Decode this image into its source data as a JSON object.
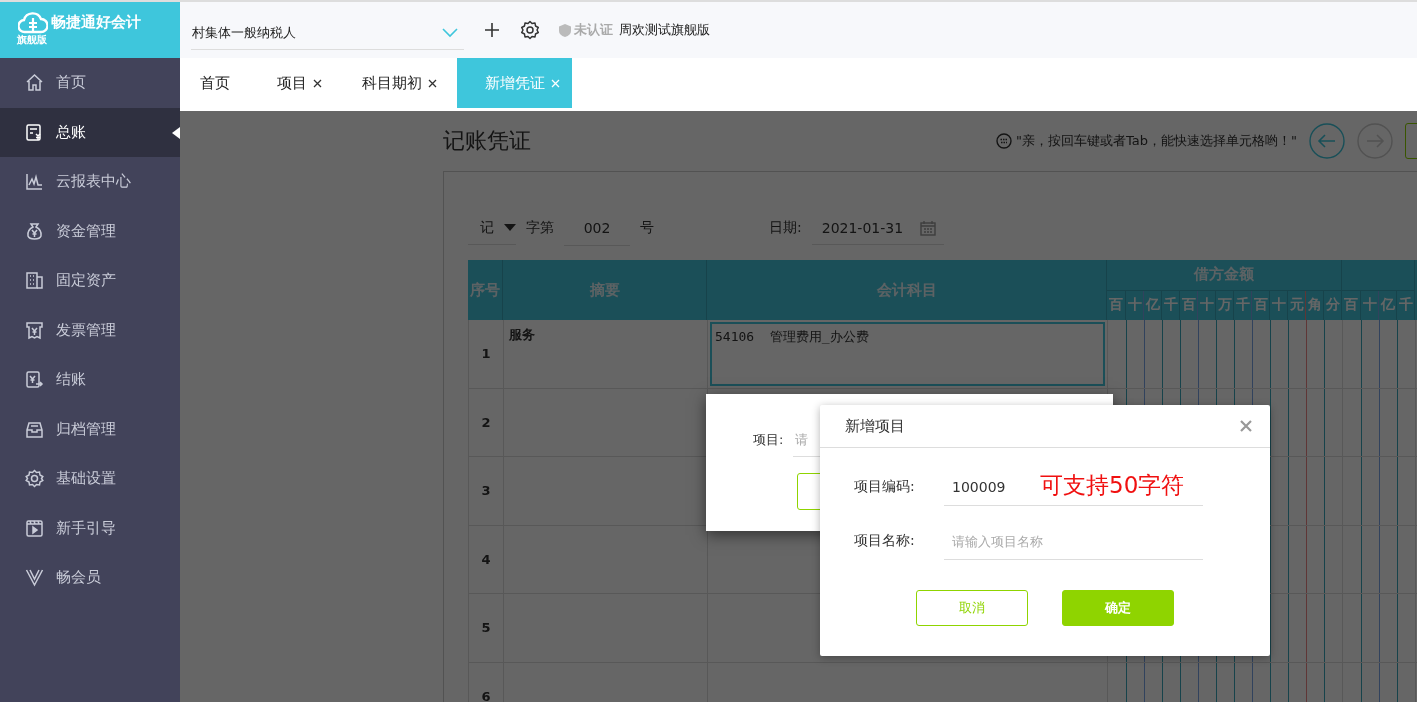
{
  "app": {
    "name": "畅捷通好会计",
    "edition": "旗舰版"
  },
  "header": {
    "company": "村集体一般纳税人",
    "cert_status": "未认证",
    "account": "周欢测试旗舰版"
  },
  "sidebar": {
    "items": [
      {
        "label": "首页",
        "selected": false
      },
      {
        "label": "总账",
        "selected": true
      },
      {
        "label": "云报表中心",
        "selected": false
      },
      {
        "label": "资金管理",
        "selected": false
      },
      {
        "label": "固定资产",
        "selected": false
      },
      {
        "label": "发票管理",
        "selected": false
      },
      {
        "label": "结账",
        "selected": false
      },
      {
        "label": "归档管理",
        "selected": false
      },
      {
        "label": "基础设置",
        "selected": false
      },
      {
        "label": "新手引导",
        "selected": false
      },
      {
        "label": "畅会员",
        "selected": false
      }
    ]
  },
  "tabs": [
    {
      "label": "首页",
      "closable": false,
      "selected": false
    },
    {
      "label": "项目",
      "closable": true,
      "selected": false
    },
    {
      "label": "科目期初",
      "closable": true,
      "selected": false
    },
    {
      "label": "新增凭证",
      "closable": true,
      "selected": true
    }
  ],
  "voucher": {
    "title": "记账凭证",
    "hint": "\"亲，按回车键或者Tab，能快速选择单元格哟！\"",
    "word": "记",
    "word_suffix": "字第",
    "number": "002",
    "number_suffix": "号",
    "date_label": "日期:",
    "date": "2021-01-31",
    "table": {
      "columns": [
        "序号",
        "摘要",
        "会计科目"
      ],
      "debit_header": "借方金额",
      "debit_units": [
        "百",
        "十",
        "亿",
        "千",
        "百",
        "十",
        "万",
        "千",
        "百",
        "十",
        "元",
        "角",
        "分"
      ],
      "credit_units": [
        "百",
        "十",
        "亿",
        "千"
      ],
      "rows": [
        {
          "index": "1",
          "summary": "服务",
          "account": "54106  管理费用_办公费",
          "selected": true
        },
        {
          "index": "2"
        },
        {
          "index": "3"
        },
        {
          "index": "4"
        },
        {
          "index": "5"
        },
        {
          "index": "6"
        }
      ]
    }
  },
  "project_picker": {
    "label": "项目:",
    "placeholder": "请"
  },
  "dialog": {
    "title": "新增项目",
    "annotation": "可支持50字符",
    "fields": [
      {
        "label": "项目编码:",
        "value": "100009"
      },
      {
        "label": "项目名称:",
        "placeholder": "请输入项目名称"
      }
    ],
    "buttons": [
      {
        "label": "取消",
        "kind": "secondary"
      },
      {
        "label": "确定",
        "kind": "primary"
      }
    ]
  }
}
